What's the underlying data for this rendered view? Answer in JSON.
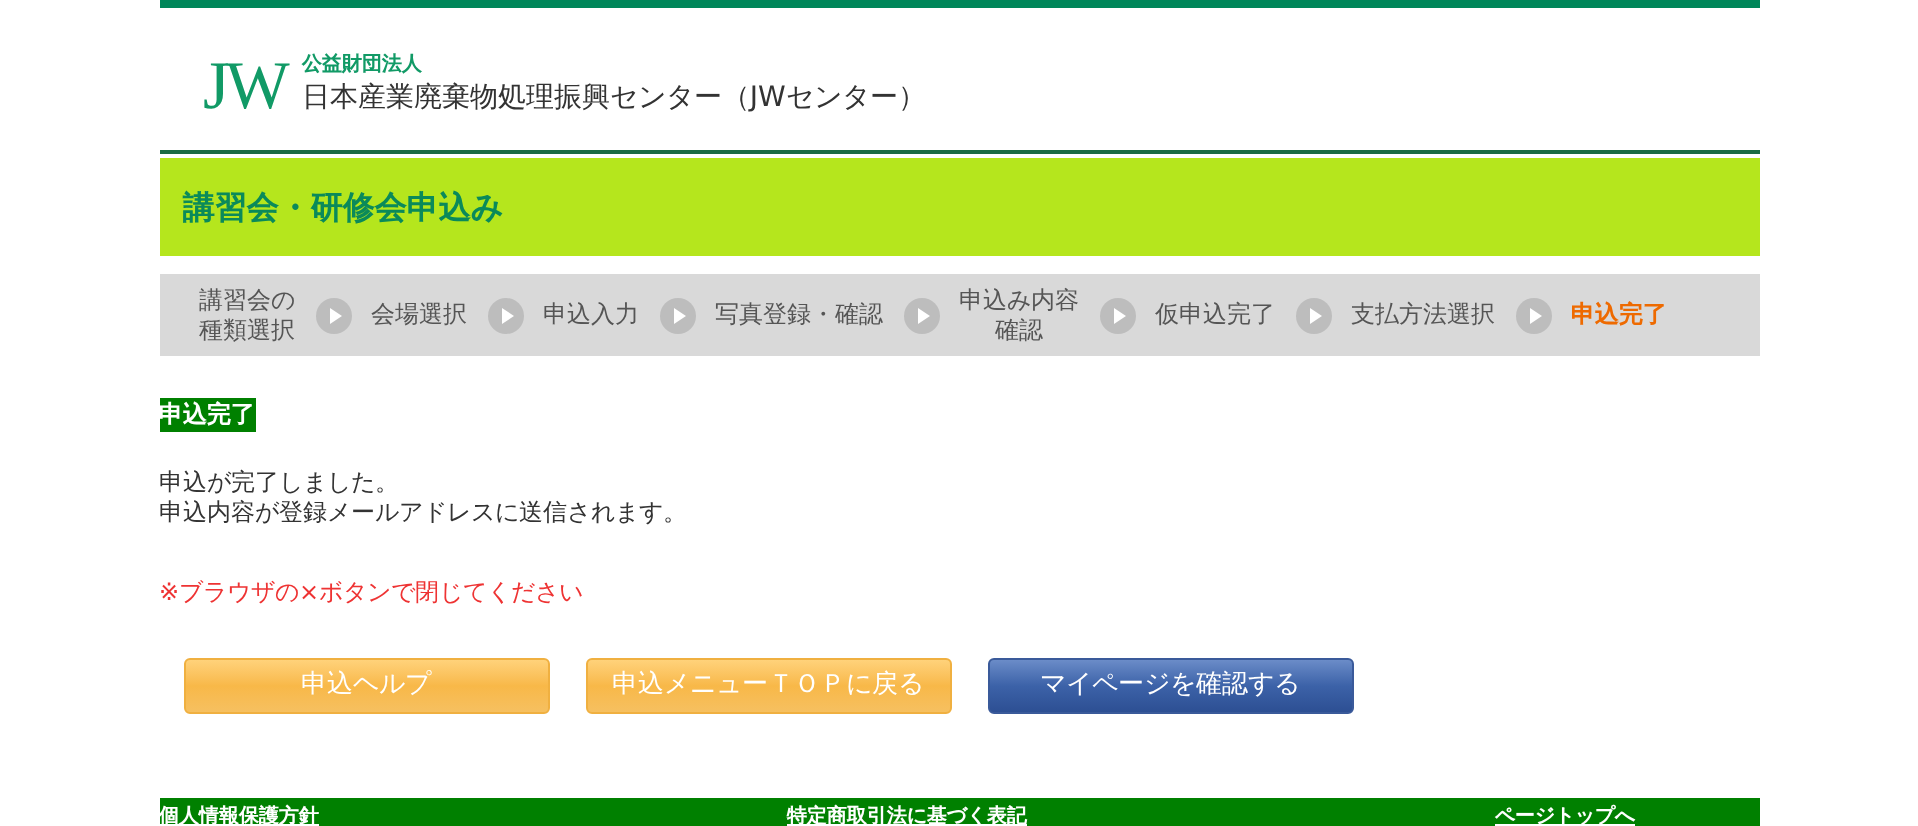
{
  "header": {
    "logo_mark": "JW",
    "org_type": "公益財団法人",
    "org_name": "日本産業廃棄物処理振興センター（JWセンター）"
  },
  "page_title": "講習会・研修会申込み",
  "steps": [
    {
      "label": [
        "講習会の",
        "種類選択"
      ],
      "selected": false
    },
    {
      "label": "会場選択",
      "selected": false
    },
    {
      "label": "申込入力",
      "selected": false
    },
    {
      "label": "写真登録・確認",
      "selected": false
    },
    {
      "label": [
        "申込み内容",
        "確認"
      ],
      "selected": false
    },
    {
      "label": "仮申込完了",
      "selected": false
    },
    {
      "label": "支払方法選択",
      "selected": false
    },
    {
      "label": "申込完了",
      "selected": true
    }
  ],
  "section_badge": "申込完了",
  "messages": [
    "申込が完了しました。",
    "申込内容が登録メールアドレスに送信されます。"
  ],
  "notice": "※ブラウザの×ボタンで閉じてください",
  "buttons": [
    {
      "label": "申込ヘルプ",
      "kind": "secondary"
    },
    {
      "label": "申込メニューＴＯＰに戻る",
      "kind": "secondary"
    },
    {
      "label": "マイページを確認する",
      "kind": "primary"
    }
  ],
  "footer_links": [
    "個人情報保護方針",
    "特定商取引法に基づく表記",
    "ページトップへ"
  ]
}
